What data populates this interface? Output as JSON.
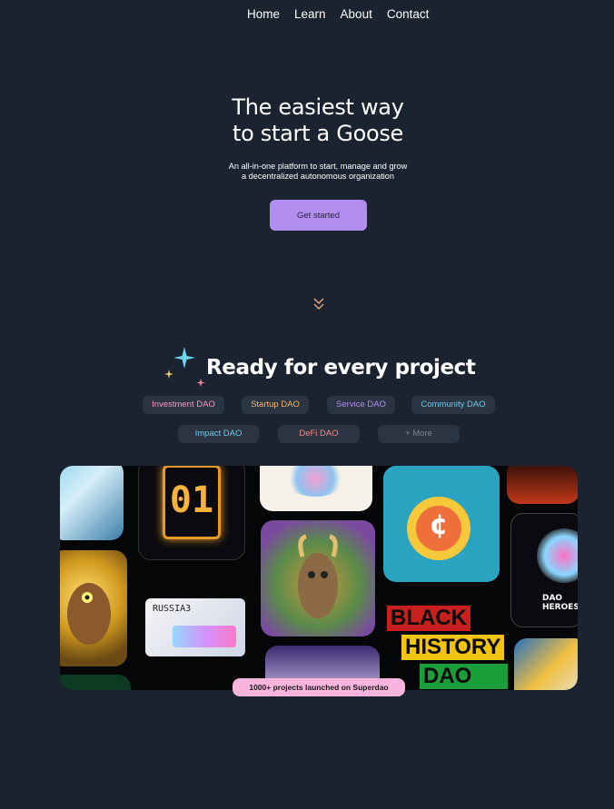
{
  "nav": {
    "items": [
      {
        "label": "Home"
      },
      {
        "label": "Learn"
      },
      {
        "label": "About"
      },
      {
        "label": "Contact"
      }
    ]
  },
  "hero": {
    "title_line1": "The easiest way",
    "title_line2": "to start a Goose",
    "subtitle_line1": "An all-in-one platform to start, manage and grow",
    "subtitle_line2": "a decentralized autonomous organization",
    "cta_label": "Get started"
  },
  "projects": {
    "title": "Ready for every project",
    "chips": [
      {
        "label": "Investment DAO",
        "color": "#f59ac6"
      },
      {
        "label": "Startup DAO",
        "color": "#f5b66a"
      },
      {
        "label": "Service DAO",
        "color": "#b28ef1"
      },
      {
        "label": "Community DAO",
        "color": "#6fc9e8"
      },
      {
        "label": "Impact DAO",
        "color": "#6fc9e8"
      },
      {
        "label": "DeFi DAO",
        "color": "#f58a8a"
      },
      {
        "label": "+ More",
        "color": "#7b8594"
      }
    ],
    "gallery_tiles": {
      "counter": "01",
      "card_name": "RUSSIA3",
      "poster_line1": "BLACK",
      "poster_line2": "HISTORY",
      "poster_line3": "DAO",
      "hero_card": "DAO HEROES"
    },
    "badge": "1000+ projects launched on Superdao"
  },
  "colors": {
    "background": "#1a232f",
    "accent": "#b28ef1",
    "badge": "#f7b4dd"
  }
}
